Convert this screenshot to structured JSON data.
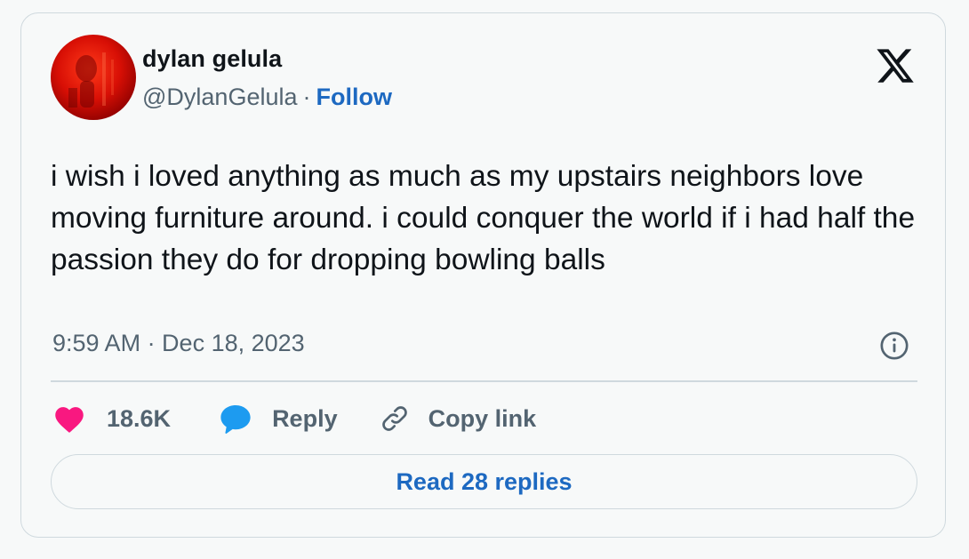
{
  "author": {
    "name": "dylan gelula",
    "handle": "@DylanGelula",
    "separator": "·",
    "follow_label": "Follow"
  },
  "tweet": {
    "text": "i wish i loved anything as much as my upstairs neighbors love moving furniture around. i could conquer the world if i had half the passion they do for dropping bowling balls",
    "timestamp": "9:59 AM · Dec 18, 2023"
  },
  "actions": {
    "like_count": "18.6K",
    "reply_label": "Reply",
    "copy_link_label": "Copy link"
  },
  "read_replies_label": "Read 28 replies",
  "colors": {
    "link_blue": "#1d69c1",
    "like_pink": "#f91880",
    "reply_blue": "#1d9bf0",
    "text_primary": "#0f1419",
    "text_secondary": "#536471",
    "border": "#cfd9de"
  },
  "icons": {
    "brand": "x-logo-icon",
    "info": "info-icon",
    "like": "heart-icon",
    "reply": "speech-bubble-icon",
    "copy": "link-icon"
  }
}
